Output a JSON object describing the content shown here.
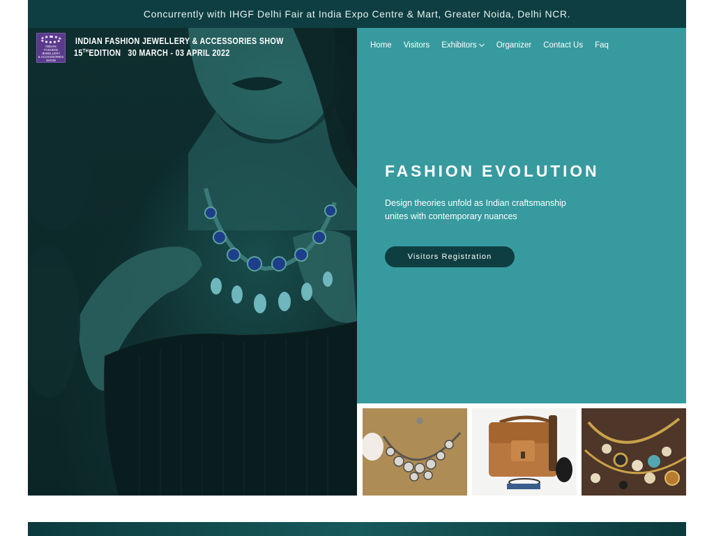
{
  "announcement": "Concurrently with IHGF Delhi Fair at India Expo Centre & Mart, Greater Noida, Delhi NCR.",
  "logo": {
    "badge_lines": [
      "Indian",
      "Fashion Jewellery",
      "& Accessories Show"
    ],
    "title": "INDIAN FASHION JEWELLERY & ACCESSORIES SHOW",
    "edition_number": "15",
    "edition_suffix": "TH",
    "edition_label": "EDITION",
    "dates": "30 MARCH - 03 APRIL 2022"
  },
  "nav": {
    "items": [
      {
        "label": "Home"
      },
      {
        "label": "Visitors"
      },
      {
        "label": "Exhibitors",
        "has_dropdown": true
      },
      {
        "label": "Organizer"
      },
      {
        "label": "Contact Us"
      },
      {
        "label": "Faq"
      }
    ]
  },
  "hero": {
    "title": "FASHION EVOLUTION",
    "subtitle_line1": "Design theories unfold as Indian craftsmanship",
    "subtitle_line2": "unites with contemporary nuances",
    "cta_label": "Visitors Registration"
  },
  "colors": {
    "topbar": "#0e3e41",
    "hero_panel": "#379a9e",
    "button": "#0e3e41"
  },
  "icons": {
    "dropdown": "chevron-down-icon"
  }
}
